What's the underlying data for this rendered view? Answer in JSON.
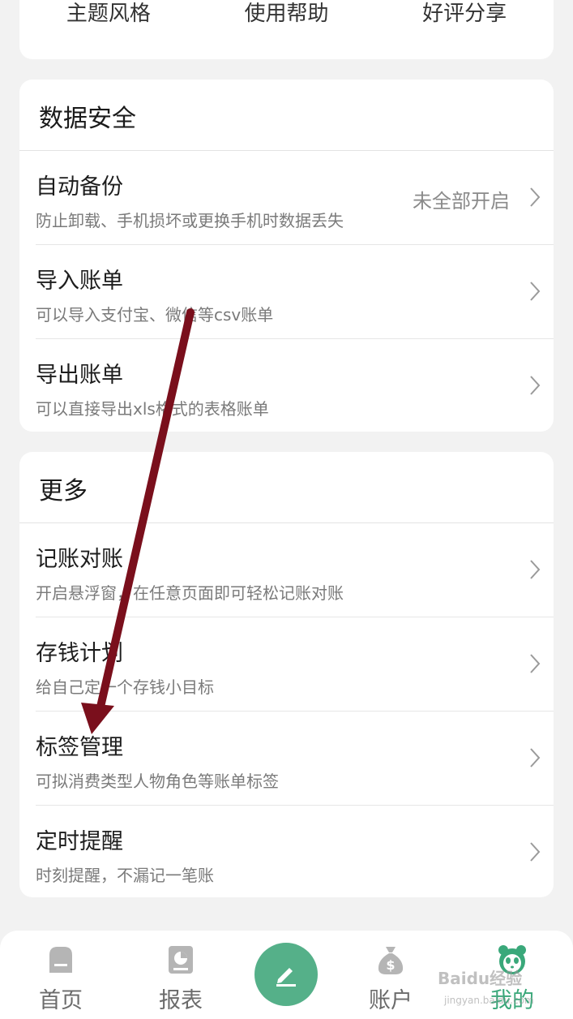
{
  "top_links": [
    "主题风格",
    "使用帮助",
    "好评分享"
  ],
  "security": {
    "title": "数据安全",
    "rows": [
      {
        "title": "自动备份",
        "subtitle": "防止卸载、手机损坏或更换手机时数据丢失",
        "value": "未全部开启"
      },
      {
        "title": "导入账单",
        "subtitle": "可以导入支付宝、微信等csv账单"
      },
      {
        "title": "导出账单",
        "subtitle": "可以直接导出xls格式的表格账单"
      }
    ]
  },
  "more": {
    "title": "更多",
    "rows": [
      {
        "title": "记账对账",
        "subtitle": "开启悬浮窗，在任意页面即可轻松记账对账"
      },
      {
        "title": "存钱计划",
        "subtitle": "给自己定一个存钱小目标"
      },
      {
        "title": "标签管理",
        "subtitle": "可拟消费类型人物角色等账单标签"
      },
      {
        "title": "定时提醒",
        "subtitle": "时刻提醒，不漏记一笔账"
      }
    ]
  },
  "tabbar": {
    "home": "首页",
    "report": "报表",
    "accounts": "账户",
    "mine": "我的",
    "active_color": "#3aa87a",
    "fab_color": "#55b089",
    "fab_icon": "pencil-icon"
  },
  "annotation": {
    "arrow_color": "#7a0f1c",
    "from": "导入账单",
    "to": "标签管理"
  },
  "watermark": {
    "line1": "Baidu经验",
    "line2": "jingyan.baidu.com"
  }
}
